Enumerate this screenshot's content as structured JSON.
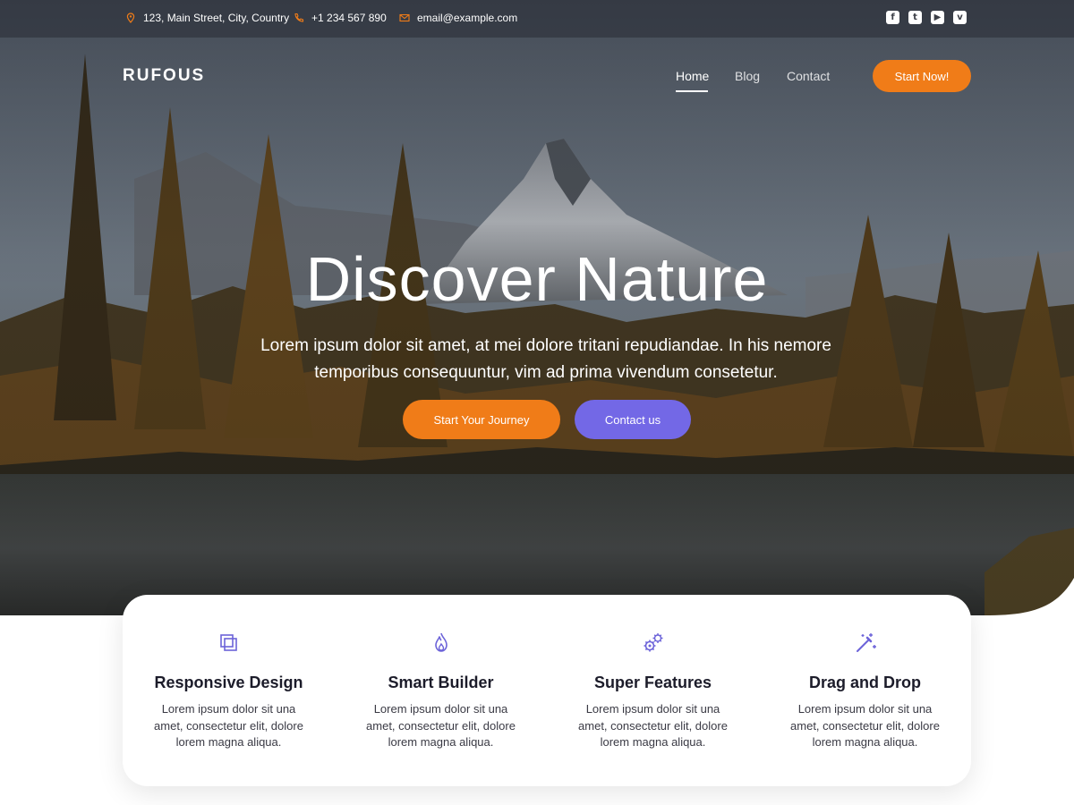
{
  "topbar": {
    "address": "123, Main Street, City, Country",
    "phone": "+1 234 567 890",
    "email": "email@example.com",
    "social": [
      {
        "name": "facebook-icon",
        "glyph": "f"
      },
      {
        "name": "twitter-icon",
        "glyph": "t"
      },
      {
        "name": "youtube-icon",
        "glyph": "▶"
      },
      {
        "name": "vimeo-icon",
        "glyph": "v"
      }
    ]
  },
  "nav": {
    "logo": "RUFOUS",
    "links": [
      "Home",
      "Blog",
      "Contact"
    ],
    "active": "Home",
    "cta": "Start Now!"
  },
  "hero": {
    "title": "Discover Nature",
    "subtitle": "Lorem ipsum dolor sit amet, at mei dolore tritani repudiandae. In his nemore temporibus consequuntur, vim ad prima vivendum consetetur.",
    "primary_button": "Start Your Journey",
    "secondary_button": "Contact us"
  },
  "features": [
    {
      "icon": "layers-icon",
      "title": "Responsive Design",
      "text": "Lorem ipsum dolor sit una amet, consectetur elit, dolore lorem magna aliqua."
    },
    {
      "icon": "flame-icon",
      "title": "Smart Builder",
      "text": "Lorem ipsum dolor sit una amet, consectetur elit, dolore lorem magna aliqua."
    },
    {
      "icon": "gears-icon",
      "title": "Super Features",
      "text": "Lorem ipsum dolor sit una amet, consectetur elit, dolore lorem magna aliqua."
    },
    {
      "icon": "magic-wand-icon",
      "title": "Drag and Drop",
      "text": "Lorem ipsum dolor sit una amet, consectetur elit, dolore lorem magna aliqua."
    }
  ],
  "colors": {
    "accent_orange": "#f07c18",
    "accent_purple": "#7368e6",
    "icon_purple": "#6c63d9",
    "heading_dark": "#1c1c2a"
  }
}
